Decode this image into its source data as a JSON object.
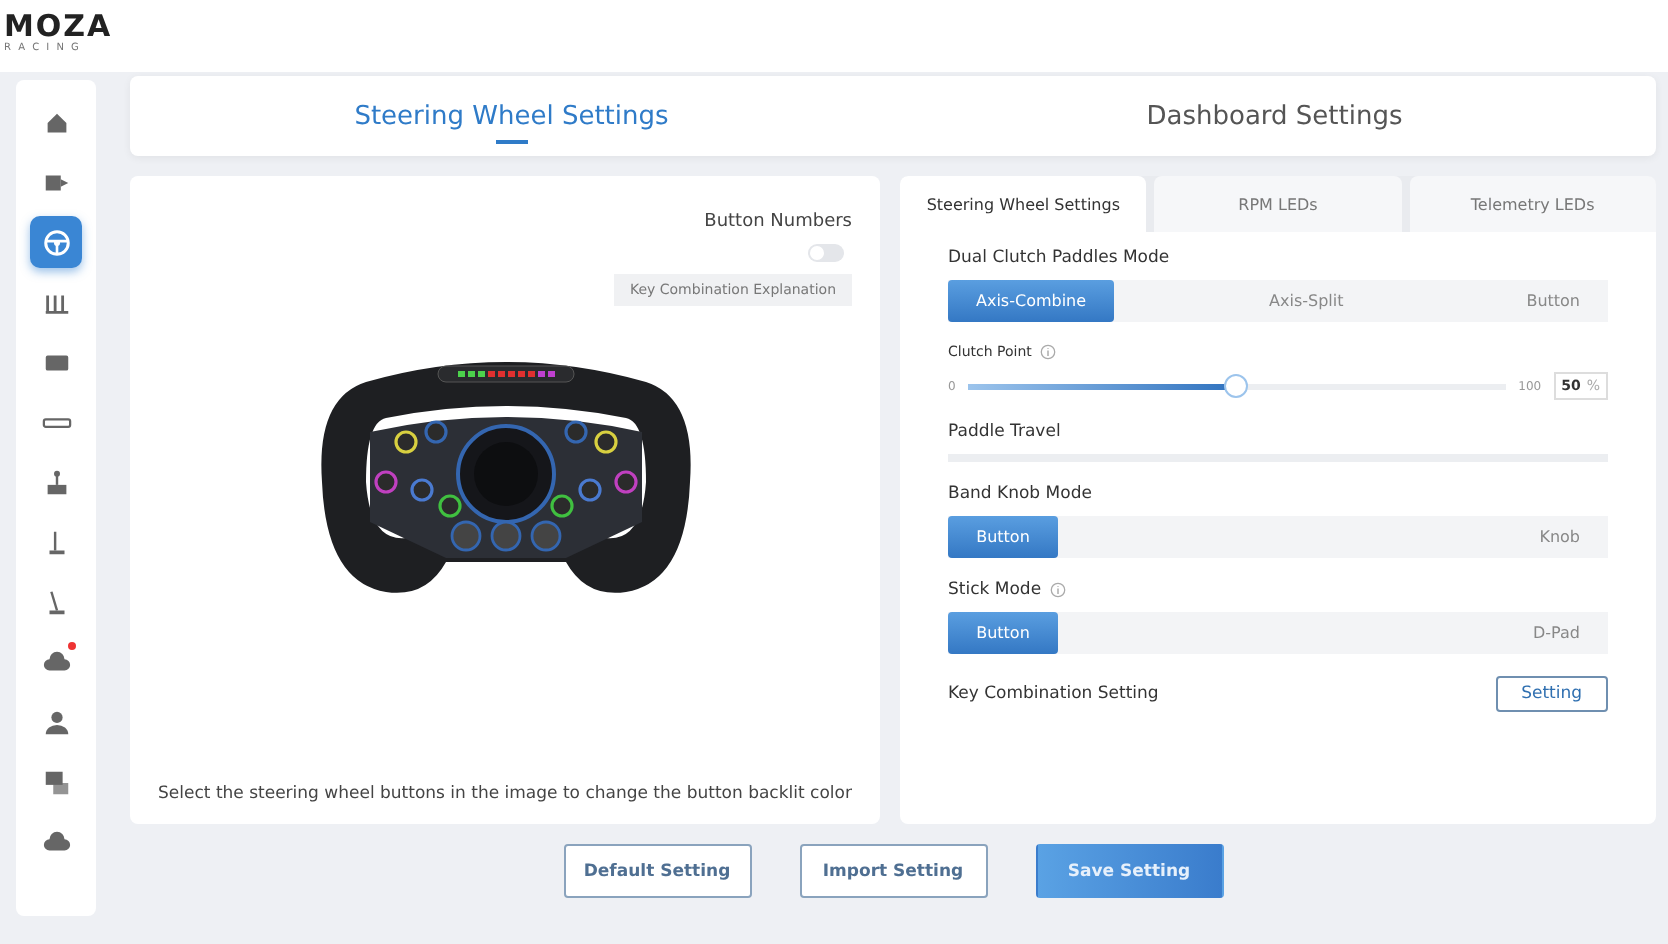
{
  "logo": {
    "brand": "MOZA",
    "sub": "R A C I N G"
  },
  "sidebar": {
    "items": [
      {
        "selected": false,
        "alert": false
      },
      {
        "selected": false,
        "alert": false
      },
      {
        "selected": true,
        "alert": false
      },
      {
        "selected": false,
        "alert": false
      },
      {
        "selected": false,
        "alert": false
      },
      {
        "selected": false,
        "alert": false
      },
      {
        "selected": false,
        "alert": false
      },
      {
        "selected": false,
        "alert": false
      },
      {
        "selected": false,
        "alert": false
      },
      {
        "selected": false,
        "alert": true
      },
      {
        "selected": false,
        "alert": false
      },
      {
        "selected": false,
        "alert": false
      },
      {
        "selected": false,
        "alert": false
      }
    ]
  },
  "top_tabs": [
    {
      "label": "Steering Wheel Settings",
      "selected": true
    },
    {
      "label": "Dashboard Settings",
      "selected": false
    }
  ],
  "wheel_panel": {
    "button_numbers": {
      "label": "Button Numbers",
      "on": false
    },
    "explain_button": "Key Combination Explanation",
    "hint": "Select the steering wheel buttons in the image to change the button backlit color"
  },
  "settings_tabs": [
    {
      "label": "Steering Wheel Settings",
      "selected": true
    },
    {
      "label": "RPM LEDs",
      "selected": false
    },
    {
      "label": "Telemetry LEDs",
      "selected": false
    }
  ],
  "settings": [
    {
      "kind": "segmented",
      "label": "Dual Clutch Paddles Mode",
      "info": false,
      "options": [
        {
          "label": "Axis-Combine",
          "selected": true
        },
        {
          "label": "Axis-Split",
          "selected": false
        },
        {
          "label": "Button",
          "selected": false
        }
      ]
    },
    {
      "kind": "slider",
      "label": "Clutch Point",
      "info": true,
      "min": "0",
      "max": "100",
      "level": 0.5,
      "value": "50",
      "unit": "%"
    },
    {
      "kind": "track",
      "label": "Paddle Travel",
      "info": false
    },
    {
      "kind": "segmented",
      "label": "Band Knob Mode",
      "info": false,
      "options": [
        {
          "label": "Button",
          "selected": true
        },
        {
          "label": "Knob",
          "selected": false
        }
      ]
    },
    {
      "kind": "segmented",
      "label": "Stick Mode",
      "info": true,
      "options": [
        {
          "label": "Button",
          "selected": true
        },
        {
          "label": "D-Pad",
          "selected": false
        }
      ]
    },
    {
      "kind": "action",
      "label": "Key Combination Setting",
      "info": false,
      "button": "Setting"
    }
  ],
  "footer_buttons": [
    {
      "label": "Default Setting",
      "primary": false
    },
    {
      "label": "Import Setting",
      "primary": false
    },
    {
      "label": "Save Setting",
      "primary": true
    }
  ]
}
